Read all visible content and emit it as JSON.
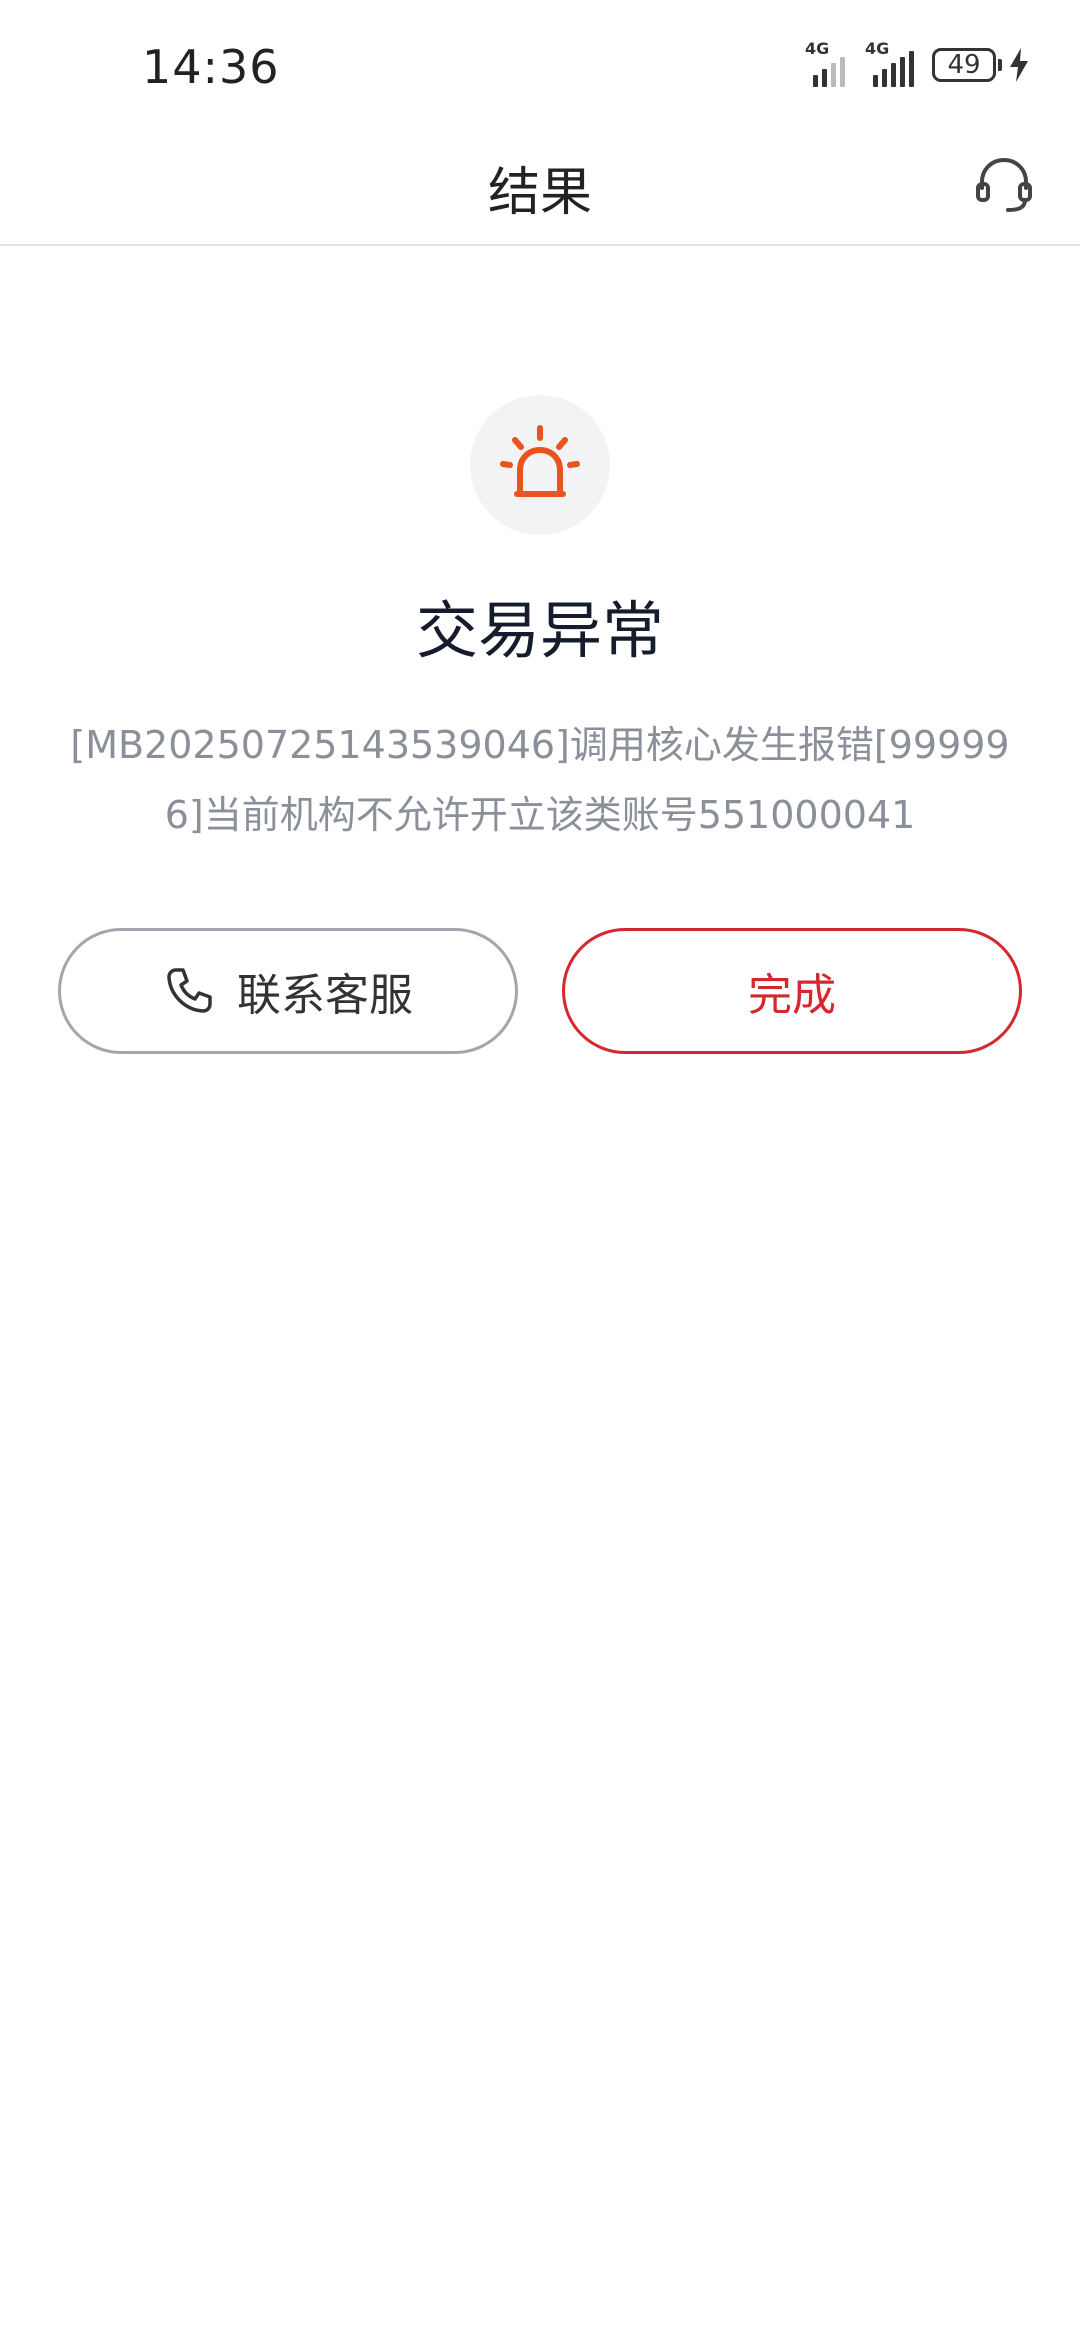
{
  "status_bar": {
    "time": "14:36",
    "network_1": "4G",
    "network_2": "4G",
    "battery": "49"
  },
  "nav": {
    "title": "结果",
    "right_icon": "headset-icon"
  },
  "result": {
    "icon": "alarm-light-icon",
    "icon_color": "#e8541e",
    "title": "交易异常",
    "message": "[MB20250725143539046]调用核心发生报错[999996]当前机构不允许开立该类账号551000041"
  },
  "actions": {
    "contact_label": "联系客服",
    "contact_icon": "phone-icon",
    "done_label": "完成",
    "done_color": "#d5272e"
  }
}
